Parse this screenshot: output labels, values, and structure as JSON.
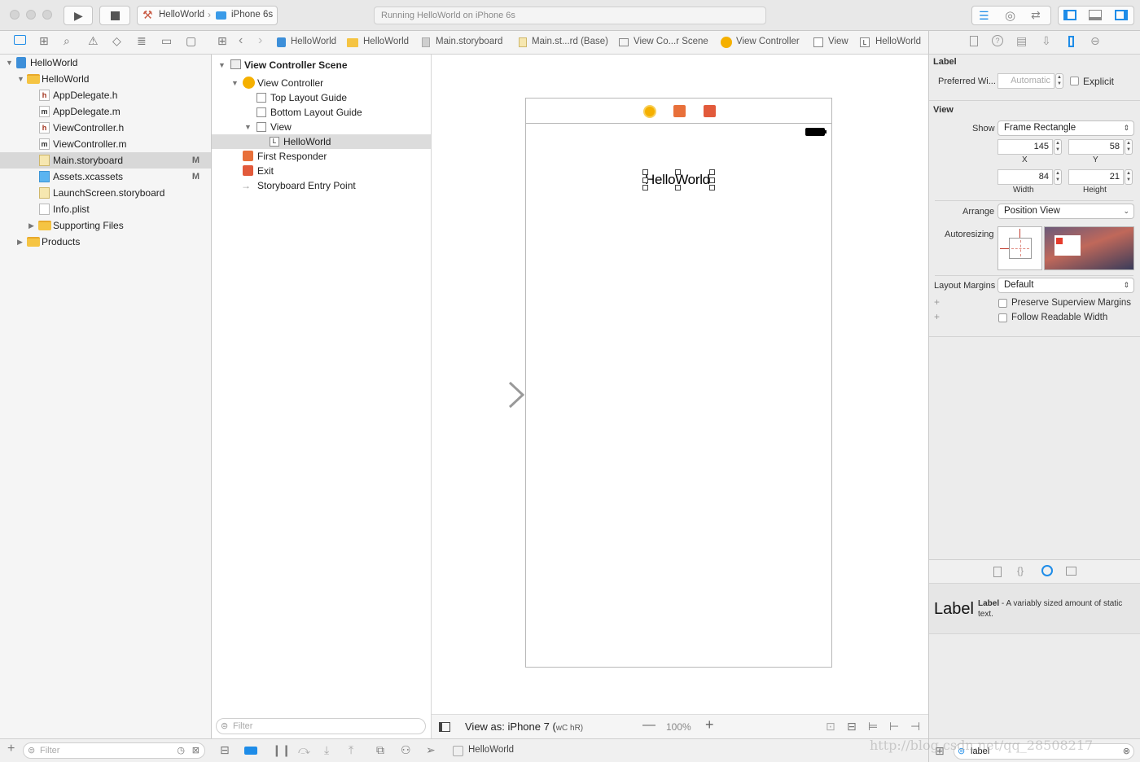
{
  "toolbar": {
    "scheme": "HelloWorld",
    "device": "iPhone 6s",
    "status": "Running HelloWorld on iPhone 6s"
  },
  "navigator": {
    "items": [
      {
        "label": "HelloWorld",
        "badge": ""
      },
      {
        "label": "HelloWorld",
        "badge": ""
      },
      {
        "label": "AppDelegate.h",
        "badge": ""
      },
      {
        "label": "AppDelegate.m",
        "badge": ""
      },
      {
        "label": "ViewController.h",
        "badge": ""
      },
      {
        "label": "ViewController.m",
        "badge": ""
      },
      {
        "label": "Main.storyboard",
        "badge": "M"
      },
      {
        "label": "Assets.xcassets",
        "badge": "M"
      },
      {
        "label": "LaunchScreen.storyboard",
        "badge": ""
      },
      {
        "label": "Info.plist",
        "badge": ""
      },
      {
        "label": "Supporting Files",
        "badge": ""
      },
      {
        "label": "Products",
        "badge": ""
      }
    ],
    "filter_placeholder": "Filter"
  },
  "breadcrumbs": [
    "HelloWorld",
    "HelloWorld",
    "Main.storyboard",
    "Main.st...rd (Base)",
    "View Co...r Scene",
    "View Controller",
    "View",
    "HelloWorld"
  ],
  "outline": {
    "items": [
      "View Controller Scene",
      "View Controller",
      "Top Layout Guide",
      "Bottom Layout Guide",
      "View",
      "HelloWorld",
      "First Responder",
      "Exit",
      "Storyboard Entry Point"
    ],
    "filter_placeholder": "Filter"
  },
  "canvas": {
    "label_text": "HelloWorld",
    "view_as": "View as: iPhone 7 (",
    "size_class": "wC hR)",
    "zoom": "100%"
  },
  "inspector": {
    "label_section": "Label",
    "preferred_width_label": "Preferred Wi...",
    "preferred_width_value": "Automatic",
    "explicit_label": "Explicit",
    "view_section": "View",
    "show_label": "Show",
    "show_value": "Frame Rectangle",
    "x_value": "145",
    "y_value": "58",
    "width_value": "84",
    "height_value": "21",
    "x_label": "X",
    "y_label": "Y",
    "width_label": "Width",
    "height_label": "Height",
    "arrange_label": "Arrange",
    "arrange_value": "Position View",
    "autoresizing_label": "Autoresizing",
    "layout_margins_label": "Layout Margins",
    "layout_margins_value": "Default",
    "preserve_label": "Preserve Superview Margins",
    "readable_label": "Follow Readable Width"
  },
  "library": {
    "preview": "Label",
    "title": "Label",
    "description": " - A variably sized amount of static text.",
    "search_value": "label"
  },
  "bottom": {
    "selection": "HelloWorld",
    "watermark": "http://blog.csdn.net/qq_28508217"
  },
  "colors": {
    "accent": "#1e8ce8",
    "vc_icon": "#f5b000",
    "responder_icon": "#e8703a",
    "exit_icon": "#e25a3b"
  }
}
